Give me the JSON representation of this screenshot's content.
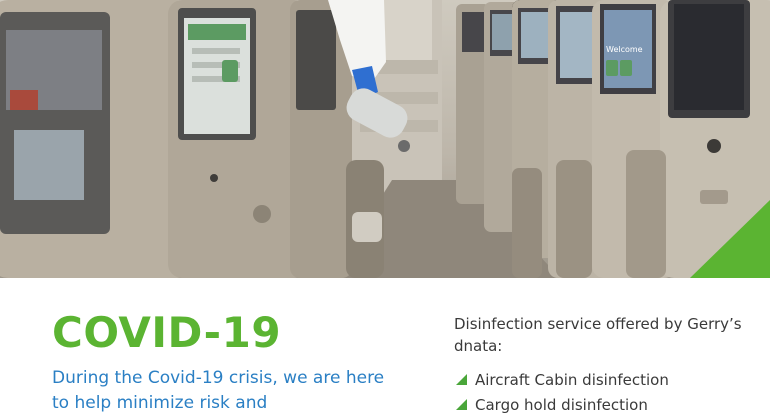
{
  "hero": {
    "screen_text": "Welcome"
  },
  "content": {
    "title": "COVID-19",
    "intro": "During the Covid-19 crisis, we are here to help minimize risk and",
    "services_heading": "Disinfection service offered by Gerry’s dnata:",
    "services": [
      {
        "label": "Aircraft Cabin disinfection"
      },
      {
        "label": "Cargo hold disinfection"
      }
    ]
  },
  "colors": {
    "title": "#5bb432",
    "intro": "#2a7fc4",
    "accent": "#4aa63a"
  }
}
